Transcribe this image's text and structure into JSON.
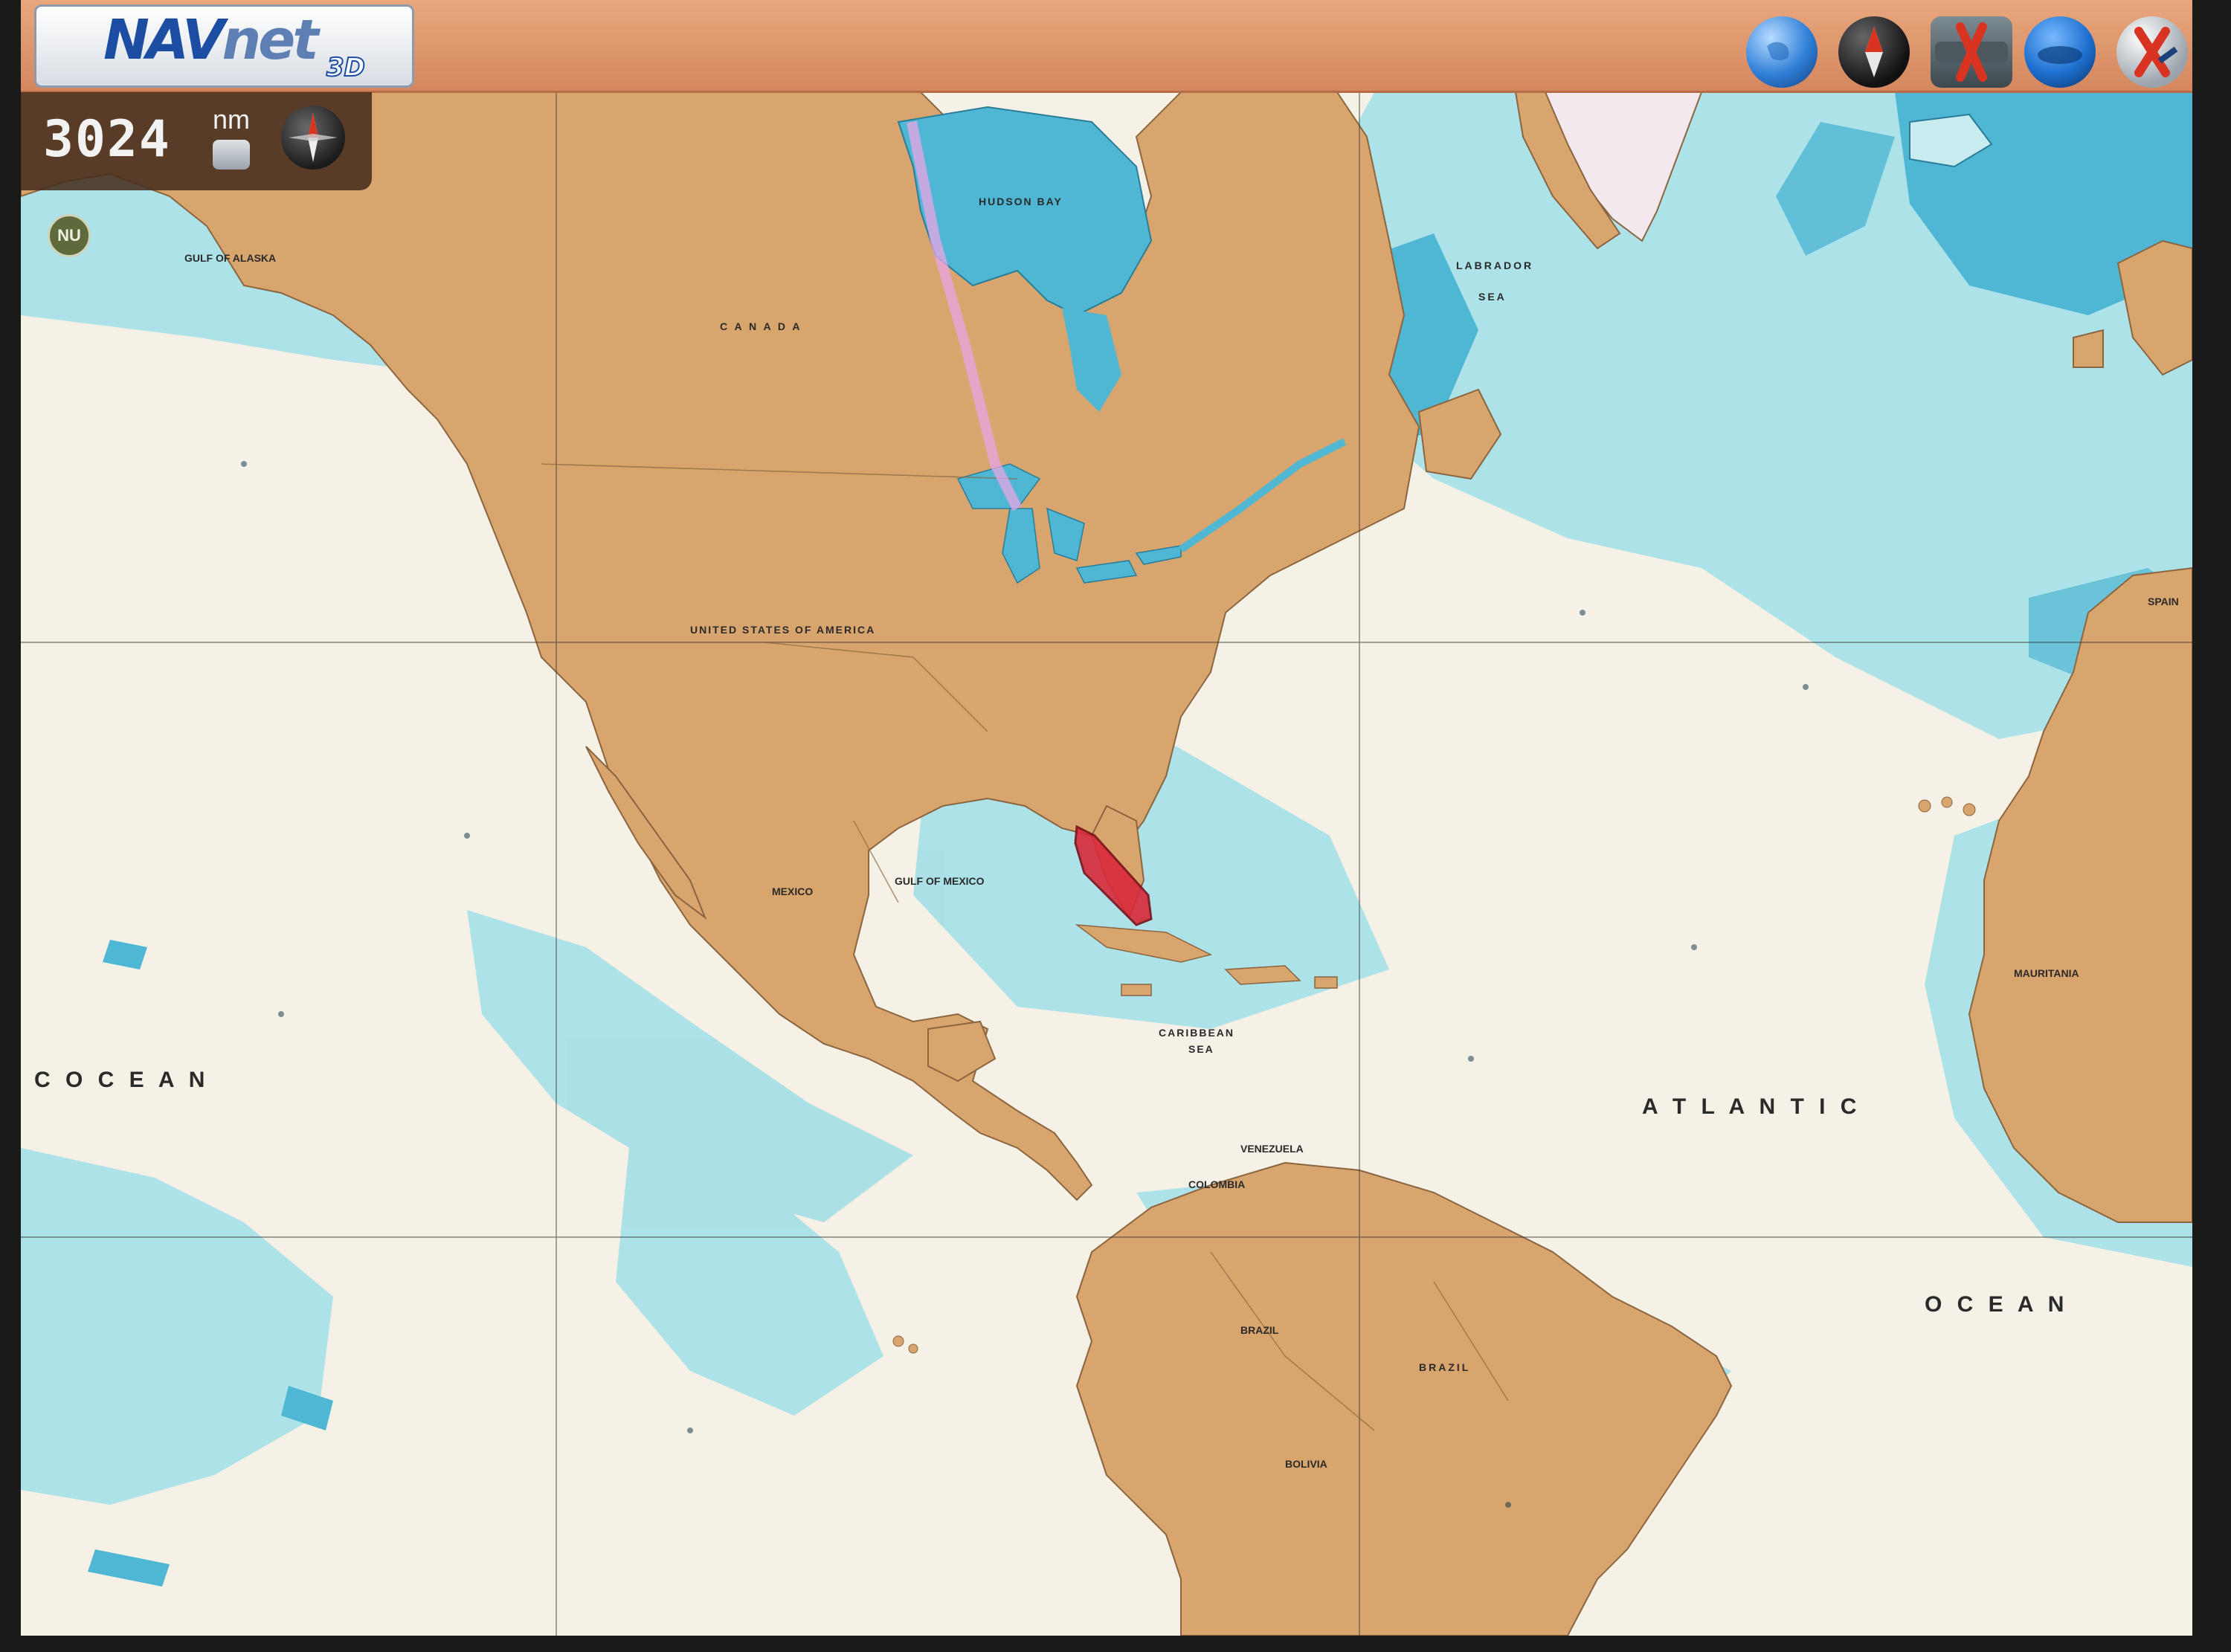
{
  "app": {
    "logo_primary": "NAV",
    "logo_secondary": "net",
    "logo_3d": "3D"
  },
  "toolbar": {
    "icons": [
      {
        "name": "globe-icon",
        "color": "#2f7fd8"
      },
      {
        "name": "compass-north-icon",
        "color": "#222222"
      },
      {
        "name": "xte-icon",
        "color": "#d93322"
      },
      {
        "name": "layer-disc-icon",
        "color": "#1d6fcf"
      },
      {
        "name": "cancel-route-icon",
        "color": "#d93322"
      }
    ]
  },
  "range": {
    "value": "3024",
    "unit": "nm"
  },
  "orientation_badge": "NU",
  "map": {
    "labels": {
      "hudson_bay": "HUDSON BAY",
      "canada": "C A N A D A",
      "labrador_sea": "LABRADOR",
      "labrador_sea_2": "SEA",
      "gulf_of_alaska": "GULF OF ALASKA",
      "usa": "UNITED STATES OF AMERICA",
      "mexico": "MEXICO",
      "gulf_of_mexico": "GULF OF MEXICO",
      "caribbean": "CARIBBEAN",
      "caribbean_2": "SEA",
      "venezuela": "VENEZUELA",
      "colombia": "COLOMBIA",
      "brazil_1": "BRAZIL",
      "brazil_2": "BRAZIL",
      "bolivia": "BOLIVIA",
      "mauritania": "MAURITANIA",
      "spain": "SPAIN",
      "atlantic": "A T L A N T I C",
      "ocean_left": "C   O C E A N",
      "ocean_right": "O C E A N"
    },
    "colors": {
      "land": "#d9a56e",
      "deep_water": "#f6f1e6",
      "shallow_water": "#9fdbe4",
      "coastal_water": "#55bcd6",
      "vessel": "#d9293a"
    }
  }
}
